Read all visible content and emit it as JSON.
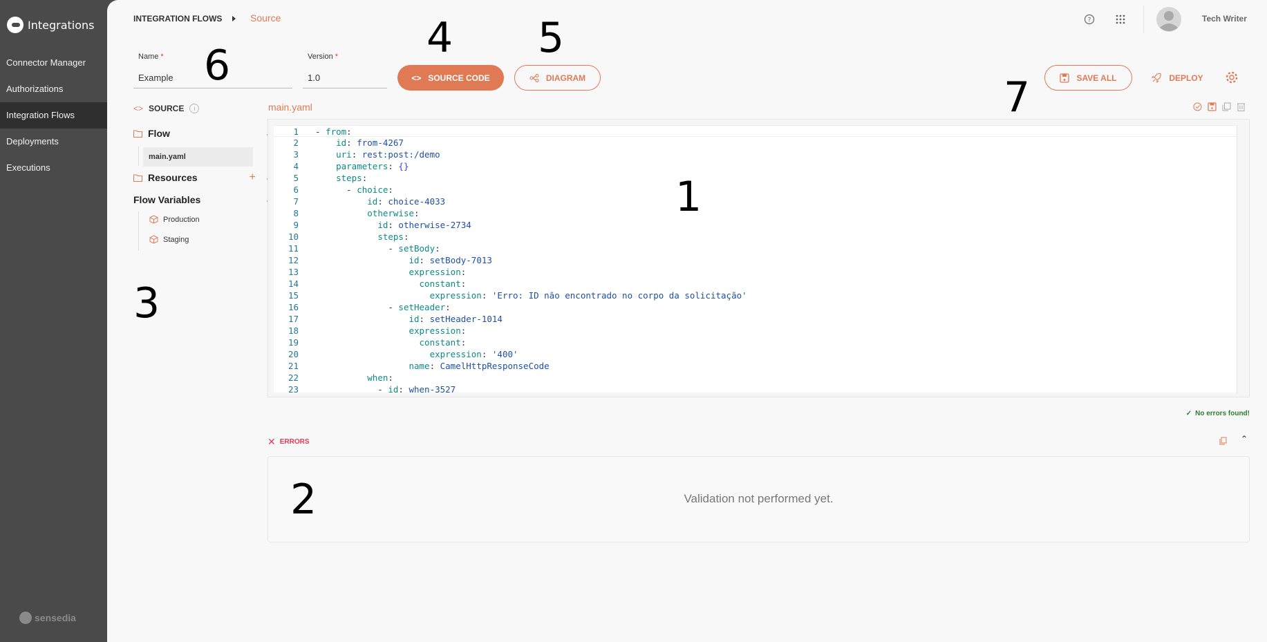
{
  "app": {
    "name": "Integrations",
    "brand_footer": "sensedia"
  },
  "sidebar": {
    "items": [
      {
        "label": "Connector Manager",
        "active": false
      },
      {
        "label": "Authorizations",
        "active": false
      },
      {
        "label": "Integration Flows",
        "active": true
      },
      {
        "label": "Deployments",
        "active": false
      },
      {
        "label": "Executions",
        "active": false
      }
    ]
  },
  "breadcrumb": {
    "parent": "INTEGRATION FLOWS",
    "current": "Source"
  },
  "header": {
    "user_name": "Tech Writer",
    "help_icon": "help-circle-icon",
    "apps_icon": "grid-icon"
  },
  "form": {
    "name": {
      "label": "Name",
      "required": "*",
      "value": "Example"
    },
    "version": {
      "label": "Version",
      "required": "*",
      "value": "1.0"
    }
  },
  "toolbar": {
    "source_code": "SOURCE CODE",
    "diagram": "DIAGRAM",
    "save_all": "SAVE ALL",
    "deploy": "DEPLOY"
  },
  "tree": {
    "source_label": "SOURCE",
    "flow": "Flow",
    "flow_files": [
      "main.yaml"
    ],
    "resources": "Resources",
    "flow_variables": "Flow Variables",
    "variables": [
      "Production",
      "Staging"
    ]
  },
  "editor": {
    "filename": "main.yaml",
    "lines": [
      "- from:",
      "    id: from-4267",
      "    uri: rest:post:/demo",
      "    parameters: {}",
      "    steps:",
      "      - choice:",
      "          id: choice-4033",
      "          otherwise:",
      "            id: otherwise-2734",
      "            steps:",
      "              - setBody:",
      "                  id: setBody-7013",
      "                  expression:",
      "                    constant:",
      "                      expression: 'Erro: ID não encontrado no corpo da solicitação'",
      "              - setHeader:",
      "                  id: setHeader-1014",
      "                  expression:",
      "                    constant:",
      "                      expression: '400'",
      "                  name: CamelHttpResponseCode",
      "          when:",
      "            - id: when-3527"
    ]
  },
  "validation": {
    "status": "No errors found!",
    "errors_label": "ERRORS",
    "empty_message": "Validation not performed yet."
  },
  "annotations": [
    "1",
    "2",
    "3",
    "4",
    "5",
    "6",
    "7"
  ],
  "colors": {
    "accent": "#e07a55",
    "sidebar": "#4a4a4a",
    "success": "#2e7d32",
    "error": "#e53950"
  }
}
